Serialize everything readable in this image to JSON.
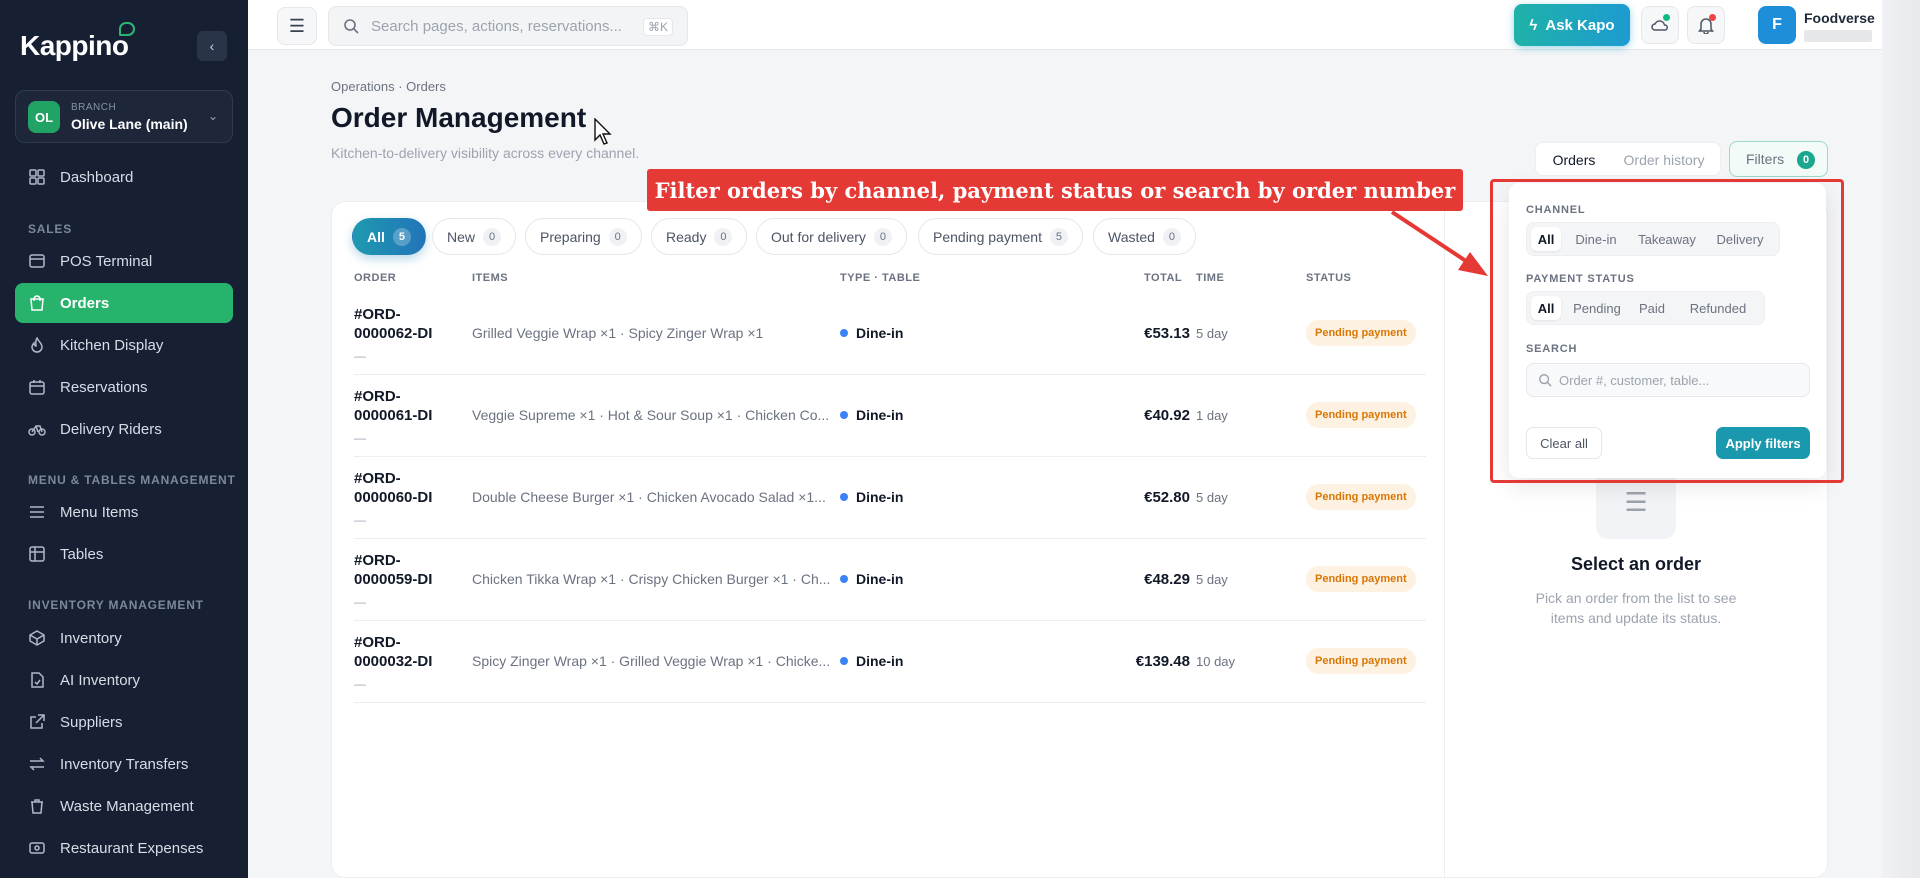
{
  "app": {
    "logo": "Kappino"
  },
  "branch": {
    "label": "BRANCH",
    "initials": "OL",
    "name": "Olive Lane (main)"
  },
  "sidebar": {
    "sections": {
      "sales": "SALES",
      "menu": "MENU & TABLES MANAGEMENT",
      "inventory": "INVENTORY MANAGEMENT"
    },
    "items": [
      {
        "label": "Dashboard"
      },
      {
        "label": "POS Terminal"
      },
      {
        "label": "Orders"
      },
      {
        "label": "Kitchen Display"
      },
      {
        "label": "Reservations"
      },
      {
        "label": "Delivery Riders"
      },
      {
        "label": "Menu Items"
      },
      {
        "label": "Tables"
      },
      {
        "label": "Inventory"
      },
      {
        "label": "AI Inventory"
      },
      {
        "label": "Suppliers"
      },
      {
        "label": "Inventory Transfers"
      },
      {
        "label": "Waste Management"
      },
      {
        "label": "Restaurant Expenses"
      }
    ]
  },
  "topbar": {
    "search_placeholder": "Search pages, actions, reservations...",
    "search_shortcut": "⌘K",
    "ask_label": "Ask Kapo",
    "user_initial": "F",
    "user_name": "Foodverse"
  },
  "header": {
    "breadcrumb": "Operations · Orders",
    "title": "Order Management",
    "subtitle": "Kitchen-to-delivery visibility across every channel."
  },
  "view_toggle": {
    "orders": "Orders",
    "history": "Order history"
  },
  "filters_button": {
    "label": "Filters",
    "count": "0"
  },
  "tabs": [
    {
      "label": "All",
      "count": "5"
    },
    {
      "label": "New",
      "count": "0"
    },
    {
      "label": "Preparing",
      "count": "0"
    },
    {
      "label": "Ready",
      "count": "0"
    },
    {
      "label": "Out for delivery",
      "count": "0"
    },
    {
      "label": "Pending payment",
      "count": "5"
    },
    {
      "label": "Wasted",
      "count": "0"
    }
  ],
  "table": {
    "headers": {
      "order": "ORDER",
      "items": "ITEMS",
      "type": "TYPE · TABLE",
      "total": "TOTAL",
      "time": "TIME",
      "status": "STATUS"
    },
    "rows": [
      {
        "order": "#ORD-0000062-DI",
        "sub": "—",
        "items": "Grilled Veggie Wrap ×1 · Spicy Zinger Wrap ×1",
        "type": "Dine-in",
        "total": "€53.13",
        "time": "5 day",
        "status": "Pending payment"
      },
      {
        "order": "#ORD-0000061-DI",
        "sub": "—",
        "items": "Veggie Supreme ×1 · Hot & Sour Soup ×1 · Chicken Co...",
        "type": "Dine-in",
        "total": "€40.92",
        "time": "1 day",
        "status": "Pending payment"
      },
      {
        "order": "#ORD-0000060-DI",
        "sub": "—",
        "items": "Double Cheese Burger ×1 · Chicken Avocado Salad ×1...",
        "type": "Dine-in",
        "total": "€52.80",
        "time": "5 day",
        "status": "Pending payment"
      },
      {
        "order": "#ORD-0000059-DI",
        "sub": "—",
        "items": "Chicken Tikka Wrap ×1 · Crispy Chicken Burger ×1 · Ch...",
        "type": "Dine-in",
        "total": "€48.29",
        "time": "5 day",
        "status": "Pending payment"
      },
      {
        "order": "#ORD-0000032-DI",
        "sub": "—",
        "items": "Spicy Zinger Wrap ×1 · Grilled Veggie Wrap ×1 · Chicke...",
        "type": "Dine-in",
        "total": "€139.48",
        "time": "10 day",
        "status": "Pending payment"
      }
    ]
  },
  "empty_state": {
    "title": "Select an order",
    "text": "Pick an order from the list to see items and update its status."
  },
  "filter_panel": {
    "channel_label": "CHANNEL",
    "channel_options": [
      "All",
      "Dine-in",
      "Takeaway",
      "Delivery"
    ],
    "payment_label": "PAYMENT STATUS",
    "payment_options": [
      "All",
      "Pending",
      "Paid",
      "Refunded"
    ],
    "search_label": "SEARCH",
    "search_placeholder": "Order #, customer, table...",
    "clear_label": "Clear all",
    "apply_label": "Apply filters"
  },
  "annotation": {
    "text": "Filter orders by channel, payment status or search by order number"
  },
  "colors": {
    "sidebar_bg": "#172033",
    "active_green": "#27b36b",
    "accent_teal": "#1a98ad",
    "annotation_red": "#e53935",
    "pending_orange": "#d97706"
  }
}
